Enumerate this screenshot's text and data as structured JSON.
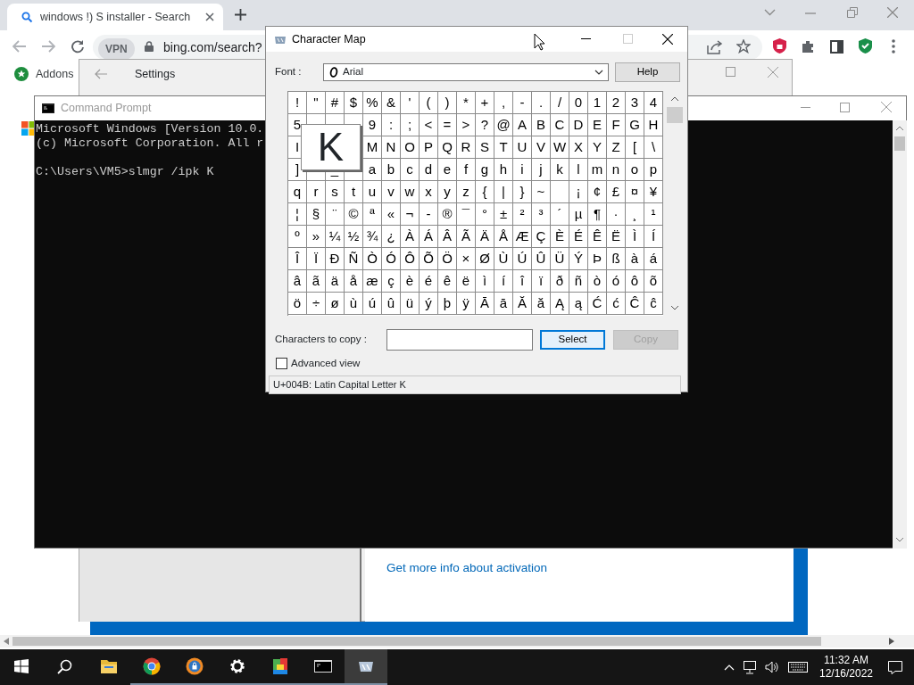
{
  "browser": {
    "tab": {
      "title": "windows !) S installer - Search",
      "selected": true
    },
    "vpn": "VPN",
    "address": "bing.com/search?",
    "bookmarks": [
      {
        "label": "Addons"
      }
    ],
    "page": {
      "link": "Get more info about activation"
    }
  },
  "settings_window": {
    "title": "Settings"
  },
  "cmd_window": {
    "title": "Command Prompt",
    "blocks": [
      [
        "Microsoft Windows [Version 10.0.",
        "(c) Microsoft Corporation. All r"
      ],
      [
        "C:\\Users\\VM5>slmgr /ipk K"
      ]
    ]
  },
  "charmap": {
    "title": "Character Map",
    "font_label": "Font :",
    "font": "Arial",
    "help": "Help",
    "rows": [
      [
        "!",
        "\"",
        "#",
        "$",
        "%",
        "&",
        "'",
        "(",
        ")",
        "*",
        "+",
        ",",
        "-",
        ".",
        "/",
        "0",
        "1",
        "2",
        "3",
        "4"
      ],
      [
        "5",
        null,
        null,
        null,
        "9",
        ":",
        ";",
        "<",
        "=",
        ">",
        "?",
        "@",
        "A",
        "B",
        "C",
        "D",
        "E",
        "F",
        "G",
        "H"
      ],
      [
        "I",
        null,
        null,
        null,
        "M",
        "N",
        "O",
        "P",
        "Q",
        "R",
        "S",
        "T",
        "U",
        "V",
        "W",
        "X",
        "Y",
        "Z",
        "[",
        "\\"
      ],
      [
        "]",
        null,
        "_",
        null,
        "a",
        "b",
        "c",
        "d",
        "e",
        "f",
        "g",
        "h",
        "i",
        "j",
        "k",
        "l",
        "m",
        "n",
        "o",
        "p"
      ],
      [
        "q",
        "r",
        "s",
        "t",
        "u",
        "v",
        "w",
        "x",
        "y",
        "z",
        "{",
        "|",
        "}",
        "~",
        null,
        "¡",
        "¢",
        "£",
        "¤",
        "¥"
      ],
      [
        "¦",
        "§",
        "¨",
        "©",
        "ª",
        "«",
        "¬",
        "-",
        "®",
        "¯",
        "°",
        "±",
        "²",
        "³",
        "´",
        "µ",
        "¶",
        "·",
        "¸",
        "¹"
      ],
      [
        "º",
        "»",
        "¼",
        "½",
        "¾",
        "¿",
        "À",
        "Á",
        "Â",
        "Ã",
        "Ä",
        "Å",
        "Æ",
        "Ç",
        "È",
        "É",
        "Ê",
        "Ë",
        "Ì",
        "Í"
      ],
      [
        "Î",
        "Ï",
        "Ð",
        "Ñ",
        "Ò",
        "Ó",
        "Ô",
        "Õ",
        "Ö",
        "×",
        "Ø",
        "Ù",
        "Ú",
        "Û",
        "Ü",
        "Ý",
        "Þ",
        "ß",
        "à",
        "á"
      ],
      [
        "â",
        "ã",
        "ä",
        "å",
        "æ",
        "ç",
        "è",
        "é",
        "ê",
        "ë",
        "ì",
        "í",
        "î",
        "ï",
        "ð",
        "ñ",
        "ò",
        "ó",
        "ô",
        "õ"
      ],
      [
        "ö",
        "÷",
        "ø",
        "ù",
        "ú",
        "û",
        "ü",
        "ý",
        "þ",
        "ÿ",
        "Ā",
        "ā",
        "Ă",
        "ă",
        "Ą",
        "ą",
        "Ć",
        "ć",
        "Ĉ",
        "ĉ"
      ]
    ],
    "popup": "K",
    "copy_label": "Characters to copy :",
    "buttons": [
      {
        "label": "Select",
        "focused": true,
        "disabled": false
      },
      {
        "label": "Copy",
        "focused": false,
        "disabled": true
      }
    ],
    "advanced_view": {
      "label": "Advanced view",
      "checked": false
    },
    "status": "U+004B: Latin Capital Letter K"
  },
  "taskbar": {
    "apps": [
      {
        "kind": "explorer",
        "running": false,
        "active": false
      },
      {
        "kind": "chrome",
        "running": true,
        "active": false
      },
      {
        "kind": "shield",
        "running": true,
        "active": false
      },
      {
        "kind": "settings",
        "running": true,
        "active": false
      },
      {
        "kind": "tiles",
        "running": true,
        "active": false
      },
      {
        "kind": "cmd",
        "running": true,
        "active": false
      },
      {
        "kind": "charmap",
        "running": true,
        "active": true
      }
    ],
    "time": "11:32 AM",
    "date": "12/16/2022"
  }
}
